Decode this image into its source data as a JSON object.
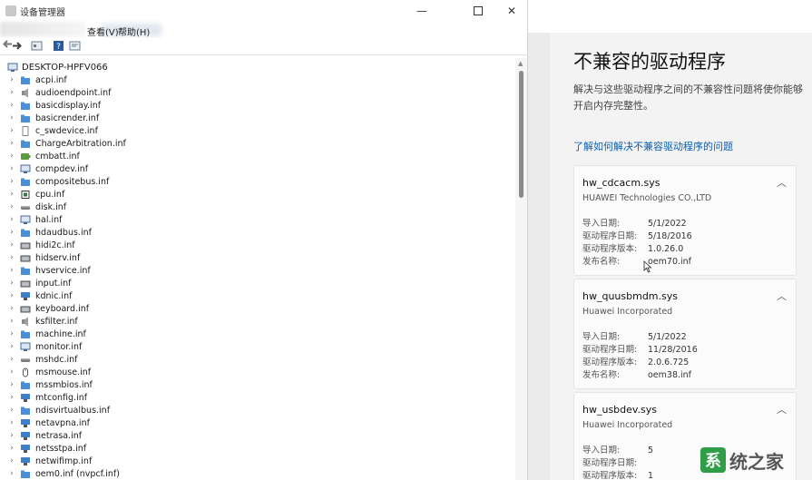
{
  "device_manager": {
    "title": "设备管理器",
    "menu": {
      "view": "查看(V)",
      "help": "帮助(H)"
    },
    "root": "DESKTOP-HPFV066",
    "items": [
      {
        "label": "acpi.inf",
        "icon": "folder-icon"
      },
      {
        "label": "audioendpoint.inf",
        "icon": "speaker-icon"
      },
      {
        "label": "basicdisplay.inf",
        "icon": "folder-icon"
      },
      {
        "label": "basicrender.inf",
        "icon": "folder-icon"
      },
      {
        "label": "c_swdevice.inf",
        "icon": "file-icon"
      },
      {
        "label": "ChargeArbitration.inf",
        "icon": "folder-icon"
      },
      {
        "label": "cmbatt.inf",
        "icon": "battery-icon"
      },
      {
        "label": "compdev.inf",
        "icon": "monitor-icon"
      },
      {
        "label": "compositebus.inf",
        "icon": "folder-icon"
      },
      {
        "label": "cpu.inf",
        "icon": "chip-icon"
      },
      {
        "label": "disk.inf",
        "icon": "disk-icon"
      },
      {
        "label": "hal.inf",
        "icon": "monitor-icon"
      },
      {
        "label": "hdaudbus.inf",
        "icon": "folder-icon"
      },
      {
        "label": "hidi2c.inf",
        "icon": "keyboard-icon"
      },
      {
        "label": "hidserv.inf",
        "icon": "keyboard-icon"
      },
      {
        "label": "hvservice.inf",
        "icon": "folder-icon"
      },
      {
        "label": "input.inf",
        "icon": "keyboard-icon"
      },
      {
        "label": "kdnic.inf",
        "icon": "network-icon"
      },
      {
        "label": "keyboard.inf",
        "icon": "keyboard-icon"
      },
      {
        "label": "ksfilter.inf",
        "icon": "speaker-icon"
      },
      {
        "label": "machine.inf",
        "icon": "folder-icon"
      },
      {
        "label": "monitor.inf",
        "icon": "monitor-icon"
      },
      {
        "label": "mshdc.inf",
        "icon": "disk-icon"
      },
      {
        "label": "msmouse.inf",
        "icon": "mouse-icon"
      },
      {
        "label": "mssmbios.inf",
        "icon": "folder-icon"
      },
      {
        "label": "mtconfig.inf",
        "icon": "network-icon"
      },
      {
        "label": "ndisvirtualbus.inf",
        "icon": "folder-icon"
      },
      {
        "label": "netavpna.inf",
        "icon": "network-icon"
      },
      {
        "label": "netrasa.inf",
        "icon": "network-icon"
      },
      {
        "label": "netsstpa.inf",
        "icon": "network-icon"
      },
      {
        "label": "netwifimp.inf",
        "icon": "network-icon"
      },
      {
        "label": "oem0.inf (nvpcf.inf)",
        "icon": "folder-icon"
      }
    ]
  },
  "panel": {
    "title": "不兼容的驱动程序",
    "description": "解决与这些驱动程序之间的不兼容性问题将使你能够开启内存完整性。",
    "link": "了解如何解决不兼容驱动程序的问题",
    "cards": [
      {
        "name": "hw_cdcacm.sys",
        "vendor": "HUAWEI Technologies CO.,LTD",
        "rows": [
          {
            "k": "导入日期:",
            "v": "5/1/2022"
          },
          {
            "k": "驱动程序日期:",
            "v": "5/18/2016"
          },
          {
            "k": "驱动程序版本:",
            "v": "1.0.26.0"
          },
          {
            "k": "发布名称:",
            "v": "oem70.inf"
          }
        ]
      },
      {
        "name": "hw_quusbmdm.sys",
        "vendor": "Huawei Incorporated",
        "rows": [
          {
            "k": "导入日期:",
            "v": "5/1/2022"
          },
          {
            "k": "驱动程序日期:",
            "v": "11/28/2016"
          },
          {
            "k": "驱动程序版本:",
            "v": "2.0.6.725"
          },
          {
            "k": "发布名称:",
            "v": "oem38.inf"
          }
        ]
      },
      {
        "name": "hw_usbdev.sys",
        "vendor": "Huawei Incorporated",
        "rows": [
          {
            "k": "导入日期:",
            "v": "5"
          },
          {
            "k": "驱动程序日期:",
            "v": ""
          },
          {
            "k": "驱动程序版本:",
            "v": "1"
          }
        ]
      }
    ]
  },
  "watermark": {
    "logo": "系",
    "text": "统之家"
  },
  "colors": {
    "link": "#0a5fb3",
    "watermark_green": "#2f9e46"
  }
}
